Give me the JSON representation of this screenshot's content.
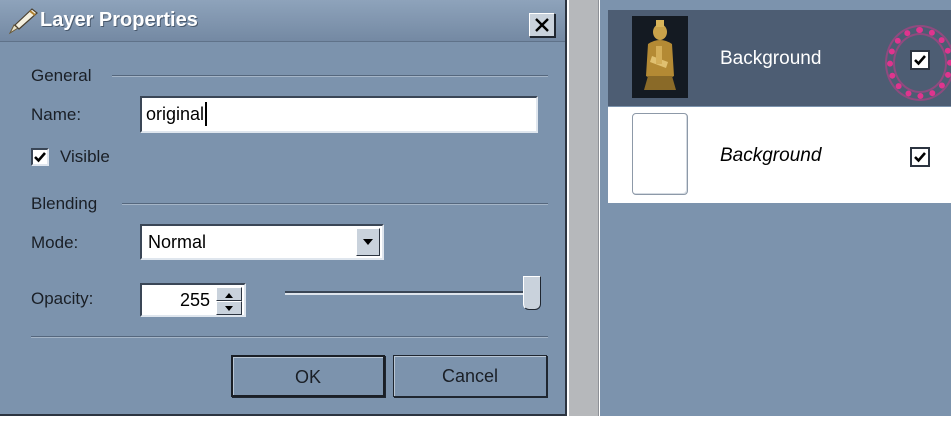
{
  "dialog": {
    "title": "Layer Properties",
    "icon": "brush-icon",
    "close_label": "close"
  },
  "general": {
    "group_label": "General",
    "name_label": "Name:",
    "name_value": "original",
    "visible_label": "Visible",
    "visible_checked": true
  },
  "blending": {
    "group_label": "Blending",
    "mode_label": "Mode:",
    "mode_value": "Normal",
    "opacity_label": "Opacity:",
    "opacity_value": "255",
    "opacity_slider_fraction": 1.0
  },
  "buttons": {
    "ok": "OK",
    "cancel": "Cancel"
  },
  "layers": {
    "items": [
      {
        "name": "Background",
        "selected": true,
        "visible": true,
        "thumbnail": "statue-image"
      },
      {
        "name": "Background",
        "selected": false,
        "visible": true,
        "thumbnail": "blank-page"
      }
    ]
  },
  "colors": {
    "panel": "#7c93ad",
    "selected_row": "#4d5d73",
    "highlight": "#e0348e"
  }
}
